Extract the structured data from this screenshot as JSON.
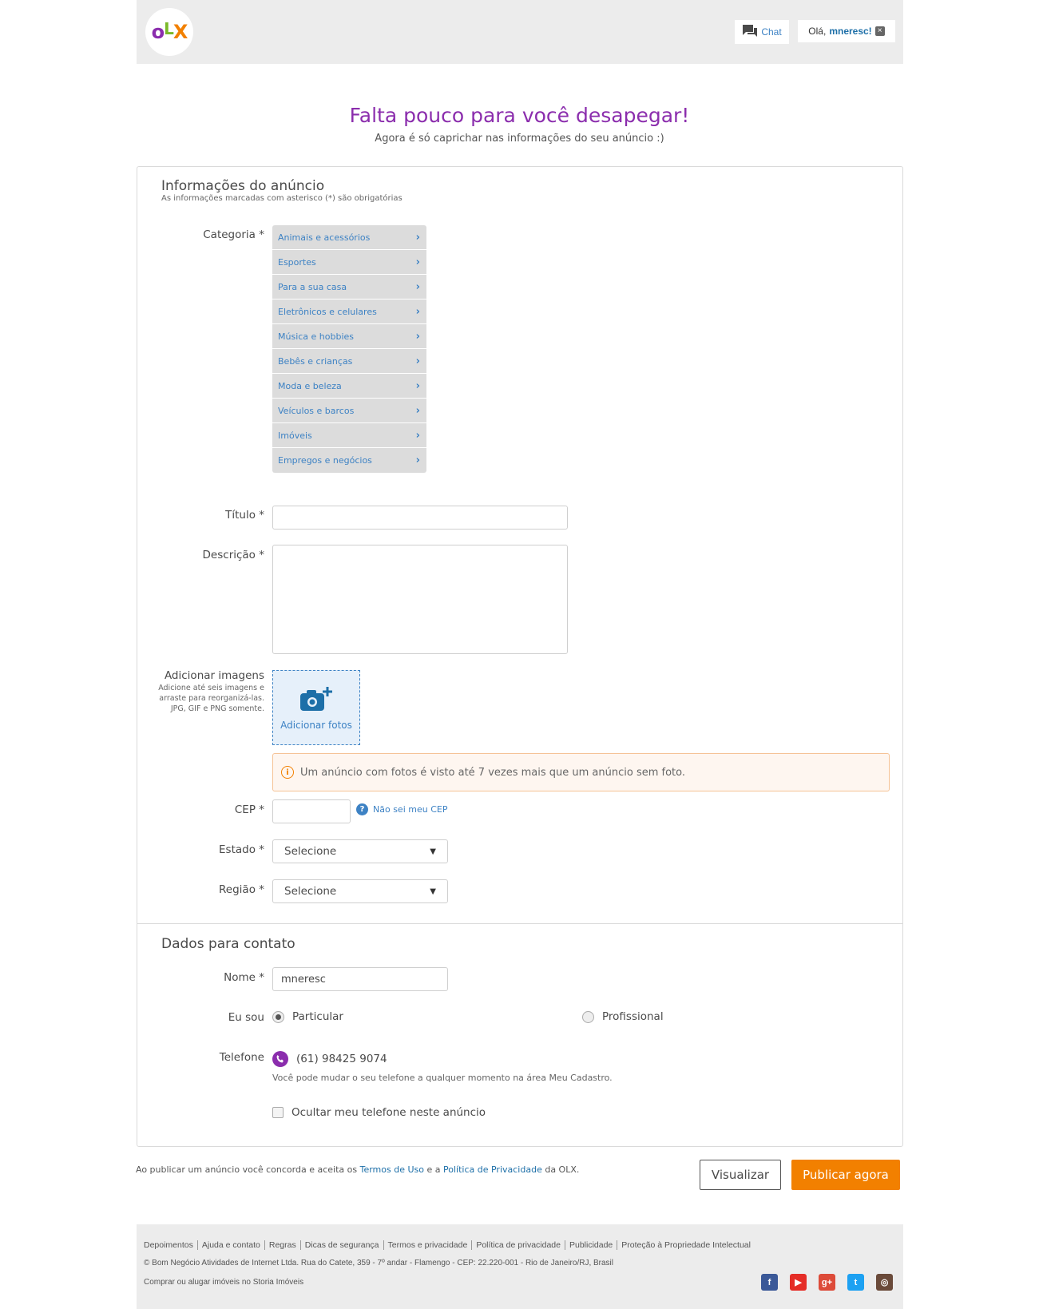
{
  "header": {
    "logo_text": [
      "o",
      "L",
      "X"
    ],
    "chat_label": "Chat",
    "greeting": "Olá,",
    "username": "mneresc!",
    "close_glyph": "×"
  },
  "hero": {
    "title": "Falta pouco para você desapegar!",
    "subtitle": "Agora é só caprichar nas informações do seu anúncio :)"
  },
  "ad_info": {
    "title": "Informações do anúncio",
    "note": "As informações marcadas com asterisco (*) são obrigatórias",
    "category_label": "Categoria *",
    "categories": [
      "Animais e acessórios",
      "Esportes",
      "Para a sua casa",
      "Eletrônicos e celulares",
      "Música e hobbies",
      "Bebês e crianças",
      "Moda e beleza",
      "Veículos e barcos",
      "Imóveis",
      "Empregos e negócios"
    ],
    "title_label": "Título *",
    "title_value": "",
    "description_label": "Descrição *",
    "description_value": "",
    "images_label": "Adicionar imagens",
    "images_note": "Adicione até seis imagens e arraste para reorganizá-las. JPG, GIF e PNG somente.",
    "add_photos_label": "Adicionar fotos",
    "photo_tip": "Um anúncio com fotos é visto até 7 vezes mais que um anúncio sem foto.",
    "cep_label": "CEP *",
    "cep_value": "",
    "cep_help": "Não sei meu CEP",
    "state_label": "Estado *",
    "state_value": "Selecione",
    "region_label": "Região *",
    "region_value": "Selecione"
  },
  "contact": {
    "title": "Dados para contato",
    "name_label": "Nome *",
    "name_value": "mneresc",
    "iam_label": "Eu sou",
    "option_particular": "Particular",
    "option_profissional": "Profissional",
    "selected": "Particular",
    "phone_label": "Telefone",
    "phone_value": "(61) 98425 9074",
    "phone_note": "Você pode mudar o seu telefone a qualquer momento na área Meu Cadastro.",
    "hide_phone_label": "Ocultar meu telefone neste anúncio",
    "hide_phone_checked": false
  },
  "actions": {
    "terms_prefix": "Ao publicar um anúncio você concorda e aceita os ",
    "terms_link": "Termos de Uso",
    "terms_mid": " e a ",
    "privacy_link": "Política de Privacidade",
    "terms_suffix": " da OLX.",
    "preview_label": "Visualizar",
    "publish_label": "Publicar agora"
  },
  "footer": {
    "links": [
      "Depoimentos",
      "Ajuda e contato",
      "Regras",
      "Dicas de segurança",
      "Termos e privacidade",
      "Política de privacidade",
      "Publicidade",
      "Proteção à Propriedade Intelectual"
    ],
    "copyright": "© Bom Negócio Atividades de Internet Ltda. Rua do Catete, 359 - 7º andar - Flamengo - CEP: 22.220-001 - Rio de Janeiro/RJ, Brasil",
    "storia": "Comprar ou alugar imóveis no Storia Imóveis",
    "social": [
      {
        "name": "facebook-icon",
        "glyph": "f",
        "color": "#3b5998"
      },
      {
        "name": "youtube-icon",
        "glyph": "▶",
        "color": "#e52d27"
      },
      {
        "name": "googleplus-icon",
        "glyph": "g+",
        "color": "#dd4b39"
      },
      {
        "name": "twitter-icon",
        "glyph": "t",
        "color": "#1da1f2"
      },
      {
        "name": "instagram-icon",
        "glyph": "◎",
        "color": "#6a4a3a"
      }
    ]
  },
  "colors": {
    "brand_purple": "#8b2dad",
    "brand_orange": "#f28000",
    "link_blue": "#3d82c4"
  }
}
